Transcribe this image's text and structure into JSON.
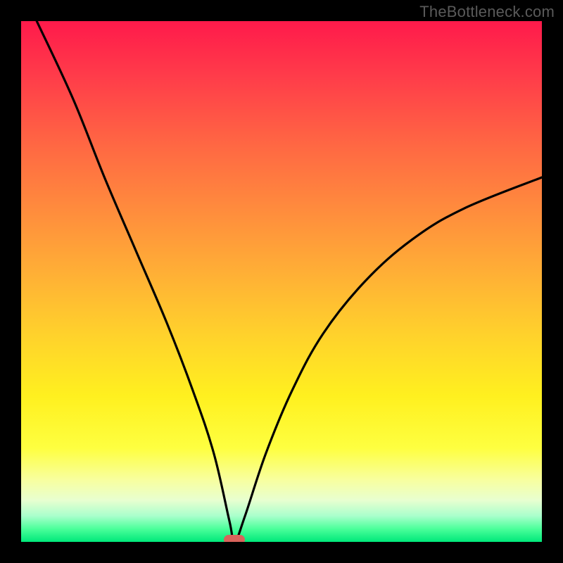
{
  "attribution": "TheBottleneck.com",
  "chart_data": {
    "type": "line",
    "title": "",
    "xlabel": "",
    "ylabel": "",
    "xlim": [
      0,
      100
    ],
    "ylim": [
      0,
      100
    ],
    "grid": false,
    "optimum_x": 41,
    "marker": {
      "x": 41,
      "y": 0,
      "color": "#d9635b"
    },
    "background_gradient": {
      "top_color": "#ff1a4b",
      "bottom_color": "#00e87a",
      "meaning": "top=high bottleneck, bottom=no bottleneck"
    },
    "series": [
      {
        "name": "bottleneck-curve",
        "x": [
          3,
          10,
          16,
          22,
          28,
          33,
          37,
          40,
          41,
          43,
          47,
          52,
          58,
          66,
          75,
          85,
          100
        ],
        "values": [
          100,
          85,
          70,
          56,
          42,
          29,
          17,
          4,
          0,
          5,
          17,
          29,
          40,
          50,
          58,
          64,
          70
        ]
      }
    ]
  }
}
